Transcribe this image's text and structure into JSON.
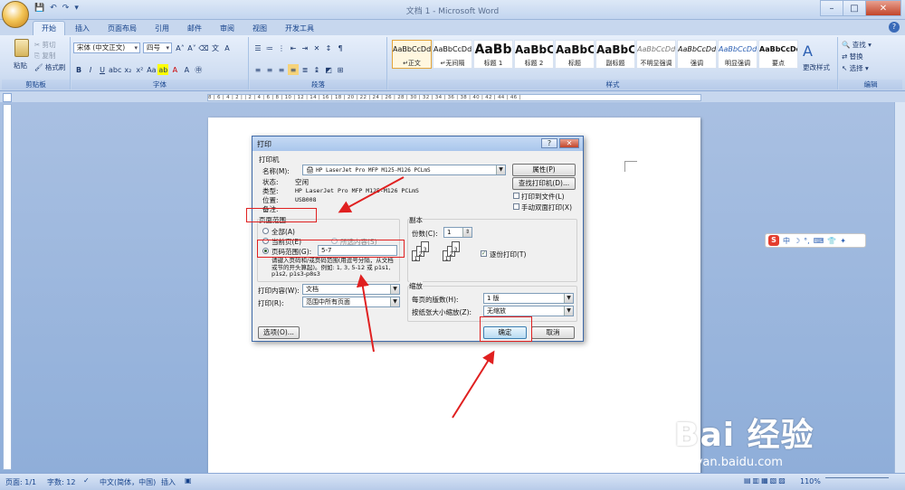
{
  "window": {
    "title": "文档 1 - Microsoft Word",
    "controls": [
      "–",
      "□",
      "✕"
    ]
  },
  "qat": [
    "💾",
    "↶",
    "↷",
    "▾"
  ],
  "tabs": [
    "开始",
    "插入",
    "页面布局",
    "引用",
    "邮件",
    "审阅",
    "视图",
    "开发工具"
  ],
  "ribbon": {
    "clipboard": {
      "paste": "粘贴",
      "cut": "剪切",
      "copy": "复制",
      "format_painter": "格式刷",
      "label": "剪贴板"
    },
    "font": {
      "name": "宋体 (中文正文)",
      "size": "四号",
      "label": "字体"
    },
    "paragraph": {
      "label": "段落"
    },
    "styles": {
      "label": "样式",
      "items": [
        {
          "sample": "AaBbCcDd",
          "name": "↵正文"
        },
        {
          "sample": "AaBbCcDd",
          "name": "↵无间隔"
        },
        {
          "sample": "AaBb",
          "name": "标题 1"
        },
        {
          "sample": "AaBbC",
          "name": "标题 2"
        },
        {
          "sample": "AaBbC",
          "name": "标题"
        },
        {
          "sample": "AaBbC",
          "name": "副标题"
        },
        {
          "sample": "AaBbCcDd",
          "name": "不明显强调"
        },
        {
          "sample": "AaBbCcDd",
          "name": "强调"
        },
        {
          "sample": "AaBbCcDd",
          "name": "明显强调"
        },
        {
          "sample": "AaBbCcDd",
          "name": "要点"
        }
      ],
      "change_styles": "更改样式"
    },
    "editing": {
      "find": "查找 ▾",
      "replace": "替换",
      "select": "选择 ▾",
      "label": "编辑"
    }
  },
  "ruler_text": "8 | 6 | 4 | 2 |  | 2 | 4 | 6 | 8 | 10 | 12 | 14 | 16 | 18 | 20 | 22 | 24 | 26 | 28 | 30 | 32 | 34 | 36 | 38 | 40 | 42 | 44 | 46 |",
  "status": {
    "page": "页面: 1/1",
    "words": "字数: 12",
    "lang": "中文(简体，中国)",
    "mode": "插入",
    "zoom": "110%"
  },
  "dialog": {
    "title": "打印",
    "printer_section": "打印机",
    "name_label": "名称(M):",
    "printer_name": "HP LaserJet Pro MFP M125-M126 PCLmS",
    "properties": "属性(P)",
    "status_label": "状态:",
    "status_value": "空闲",
    "type_label": "类型:",
    "type_value": "HP LaserJet Pro MFP M125-M126 PCLmS",
    "where_label": "位置:",
    "where_value": "USB008",
    "comment_label": "备注:",
    "find_printer": "查找打印机(D)...",
    "print_to_file": "打印到文件(L)",
    "manual_duplex": "手动双面打印(X)",
    "page_range": "页面范围",
    "all": "全部(A)",
    "current_page": "当前页(E)",
    "selection": "所选内容(S)",
    "pages": "页码范围(G):",
    "pages_value": "5-7",
    "hint": "请键入页码和/或页码范围(用逗号分隔，从文档或节的开头算起)。例如: 1, 3, 5-12 或 p1s1, p1s2, p1s3-p8s3",
    "copies_section": "副本",
    "copies_label": "份数(C):",
    "copies_value": "1",
    "collate": "逐份打印(T)",
    "print_what_label": "打印内容(W):",
    "print_what_value": "文档",
    "print_label": "打印(R):",
    "print_value": "范围中所有页面",
    "zoom_section": "缩放",
    "pages_per_sheet_label": "每页的版数(H):",
    "pages_per_sheet_value": "1 版",
    "scale_label": "按纸张大小缩放(Z):",
    "scale_value": "无缩放",
    "options": "选项(O)...",
    "ok": "确定",
    "cancel": "取消",
    "title_buttons": [
      "?",
      "✕"
    ]
  },
  "ime": {
    "logo": "S",
    "items": [
      "中",
      "☽",
      "°,",
      "⌨",
      "👕",
      "✦"
    ]
  },
  "watermark": {
    "main": "Bai 经验",
    "sub": "jingyan.baidu.com"
  },
  "colors": {
    "annotation": "#e02020",
    "accent": "#15428b"
  }
}
